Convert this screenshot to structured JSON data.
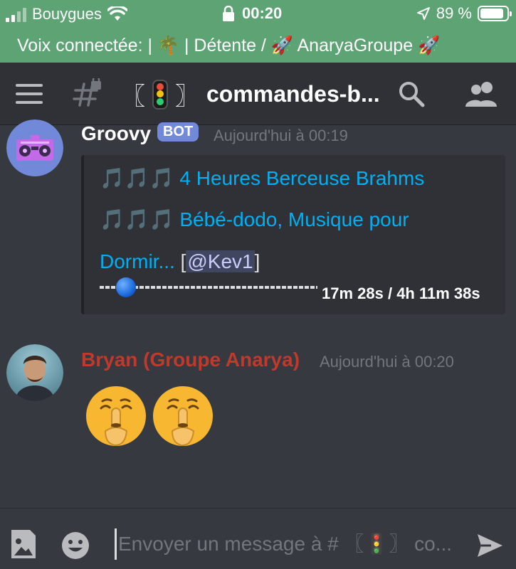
{
  "status_bar": {
    "carrier": "Bouygues",
    "time": "00:20",
    "battery": "89 %",
    "battery_level": 0.89
  },
  "voice_banner": {
    "text": "Voix connectée:  | 🌴 | Détente / 🚀 AnaryaGroupe 🚀"
  },
  "header": {
    "channel_name": "commandes-b...",
    "bracket_left": "〖",
    "bracket_right": "〗"
  },
  "messages": [
    {
      "author": "Groovy",
      "author_color": "#ffffff",
      "badge": "BOT",
      "timestamp": "Aujourd'hui à 00:19",
      "embed": {
        "line1": "🎵🎵🎵 4 Heures Berceuse Brahms",
        "line2": "🎵🎵🎵 Bébé-dodo, Musique pour",
        "line3_link": "Dormir...",
        "mention_open": " [",
        "mention": "@Kev1",
        "mention_close": "]",
        "progress_time": "17m 28s / 4h 11m 38s",
        "progress_fraction": 0.069
      }
    },
    {
      "author": "Bryan (Groupe Anarya)",
      "author_color": "#c0392b",
      "timestamp": "Aujourd'hui à 00:20",
      "emojis": [
        "shushing-face",
        "shushing-face"
      ]
    }
  ],
  "composer": {
    "placeholder": "Envoyer un message à # 〖🚦〗 co..."
  },
  "colors": {
    "background": "#36393f",
    "header": "#2f3136",
    "banner": "#5ea374",
    "link": "#00b0f4",
    "bot_badge": "#7289da"
  }
}
